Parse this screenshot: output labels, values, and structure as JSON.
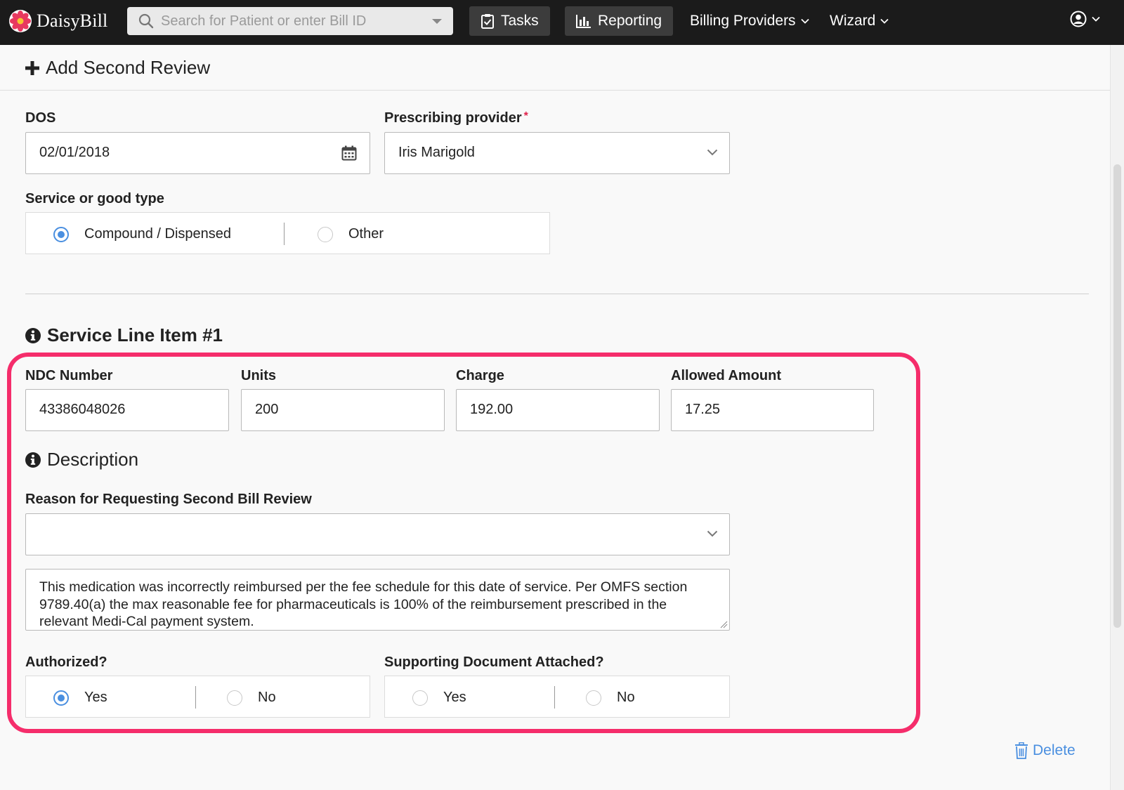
{
  "app": {
    "name": "DaisyBill",
    "search_placeholder": "Search for Patient or enter Bill ID"
  },
  "nav": {
    "tasks": "Tasks",
    "reporting": "Reporting",
    "billing_providers": "Billing Providers",
    "wizard": "Wizard"
  },
  "header": {
    "title": "Add Second Review"
  },
  "form": {
    "dos_label": "DOS",
    "dos_value": "02/01/2018",
    "provider_label": "Prescribing provider",
    "provider_required_mark": "*",
    "provider_value": "Iris Marigold",
    "service_type_label": "Service or good type",
    "service_type_options": [
      "Compound / Dispensed",
      "Other"
    ],
    "service_type_selected": "Compound / Dispensed"
  },
  "line_item": {
    "title": "Service Line Item #1",
    "ndc_label": "NDC Number",
    "ndc_value": "43386048026",
    "units_label": "Units",
    "units_value": "200",
    "charge_label": "Charge",
    "charge_value": "192.00",
    "allowed_label": "Allowed Amount",
    "allowed_value": "17.25",
    "description_title": "Description",
    "reason_label": "Reason for Requesting Second Bill Review",
    "reason_value": "",
    "description_text": "This medication was incorrectly reimbursed per the fee schedule for this date of service. Per OMFS section 9789.40(a) the max reasonable fee for pharmaceuticals is 100% of the reimbursement prescribed in the relevant Medi-Cal payment system.",
    "authorized_label": "Authorized?",
    "authorized_options": [
      "Yes",
      "No"
    ],
    "authorized_selected": "Yes",
    "supporting_label": "Supporting Document Attached?",
    "supporting_options": [
      "Yes",
      "No"
    ],
    "supporting_selected": "",
    "delete_label": "Delete"
  },
  "colors": {
    "navbar": "#1b1b1b",
    "accent_blue": "#4a8fe0",
    "highlight": "#f52d6b",
    "required": "#e0224b"
  }
}
